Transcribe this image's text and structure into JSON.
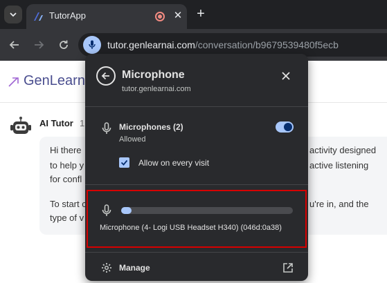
{
  "browser": {
    "tab": {
      "title": "TutorApp",
      "close_glyph": "✕"
    },
    "new_tab_glyph": "+",
    "address": {
      "host": "tutor.genlearnai.com",
      "path": "/conversation/b9679539480f5ecb"
    }
  },
  "page": {
    "logo_text": "GenLearn",
    "message": {
      "sender": "AI Tutor",
      "time_partial": "1",
      "lines": [
        "Hi there",
        "to help y",
        "for confl",
        "To start c",
        "type of v"
      ],
      "right_lines": [
        "activity designed",
        "active listening",
        "u're in, and the"
      ]
    }
  },
  "popup": {
    "title": "Microphone",
    "site": "tutor.genlearnai.com",
    "permission": {
      "label": "Microphones (2)",
      "status": "Allowed",
      "enabled": true
    },
    "allow_every_visit": {
      "label": "Allow on every visit",
      "checked": true
    },
    "device": {
      "name": "Microphone (4- Logi USB Headset H340) (046d:0a38)",
      "level_fraction": 0.06
    },
    "manage_label": "Manage",
    "close_glyph": "✕"
  },
  "colors": {
    "accent": "#a8c7fa",
    "highlight_border": "#d80000",
    "popup_bg": "#292a2d"
  }
}
